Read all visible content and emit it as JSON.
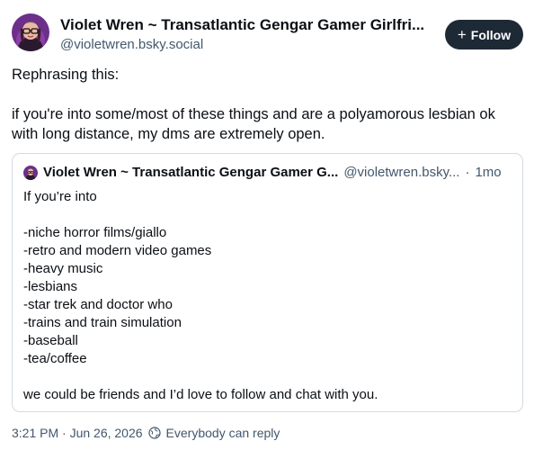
{
  "author": {
    "display_name": "Violet Wren ~ Transatlantic Gengar Gamer Girlfri...",
    "handle": "@violetwren.bsky.social"
  },
  "follow_button": {
    "icon": "plus-icon",
    "label": "Follow"
  },
  "post": {
    "lines": [
      "Rephrasing this:",
      "",
      "if you're into some/most of these things and are a polyamorous lesbian ok with long distance, my dms are extremely open."
    ]
  },
  "quote": {
    "display_name": "Violet Wren ~ Transatlantic Gengar Gamer G...",
    "handle": "@violetwren.bsky...",
    "time_ago": "1mo",
    "separator": "·",
    "lines": [
      "If you’re into",
      "",
      "-niche horror films/giallo",
      "-retro and modern video games",
      "-heavy music",
      "-lesbians",
      "-star trek and doctor who",
      "-trains and train simulation",
      "-baseball",
      "-tea/coffee",
      "",
      "we could be friends and I’d love to follow and chat with you."
    ]
  },
  "meta": {
    "timestamp": "3:21 PM · Jun 26, 2026",
    "reply_icon": "globe-icon",
    "reply_setting": "Everybody can reply"
  },
  "colors": {
    "text": "#0b0f14",
    "muted": "#42576c",
    "button_bg": "#1e2936",
    "border": "#d4dbe2"
  }
}
